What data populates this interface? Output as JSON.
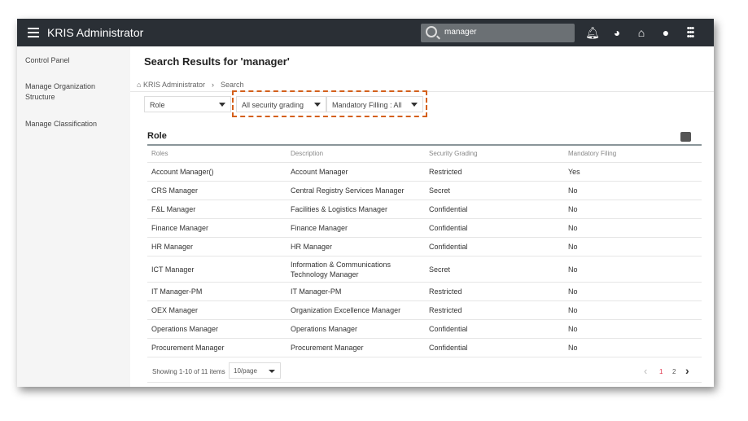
{
  "app": {
    "title": "KRIS Administrator",
    "search_value": "manager"
  },
  "sidebar": {
    "items": [
      {
        "label": "Control Panel"
      },
      {
        "label": "Manage Organization Structure"
      },
      {
        "label": "Manage Classification"
      }
    ]
  },
  "page": {
    "title": "Search Results for 'manager'",
    "breadcrumb": [
      "KRIS Administrator",
      "Search"
    ]
  },
  "filters": {
    "type": "Role",
    "security": "All security grading",
    "mandatory": "Mandatory Filling : All"
  },
  "section": {
    "heading": "Role"
  },
  "table": {
    "headers": [
      "Roles",
      "Description",
      "Security Grading",
      "Mandatory Filing"
    ],
    "rows": [
      [
        "Account Manager()",
        "Account Manager",
        "Restricted",
        "Yes"
      ],
      [
        "CRS Manager",
        "Central Registry Services Manager",
        "Secret",
        "No"
      ],
      [
        "F&L Manager",
        "Facilities & Logistics Manager",
        "Confidential",
        "No"
      ],
      [
        "Finance Manager",
        "Finance Manager",
        "Confidential",
        "No"
      ],
      [
        "HR Manager",
        "HR Manager",
        "Confidential",
        "No"
      ],
      [
        "ICT Manager",
        "Information & Communications Technology Manager",
        "Secret",
        "No"
      ],
      [
        "IT Manager-PM",
        "IT Manager-PM",
        "Restricted",
        "No"
      ],
      [
        "OEX Manager",
        "Organization Excellence Manager",
        "Restricted",
        "No"
      ],
      [
        "Operations Manager",
        "Operations Manager",
        "Confidential",
        "No"
      ],
      [
        "Procurement Manager",
        "Procurement Manager",
        "Confidential",
        "No"
      ]
    ]
  },
  "pagination": {
    "summary": "Showing 1-10 of 11 items",
    "page_size": "10/page",
    "pages": [
      "1",
      "2"
    ],
    "current": "1",
    "prev": "‹",
    "next": "›"
  },
  "colors": {
    "header": "#2a2f35",
    "highlight": "#d4601c",
    "active_page": "#e0334b"
  }
}
